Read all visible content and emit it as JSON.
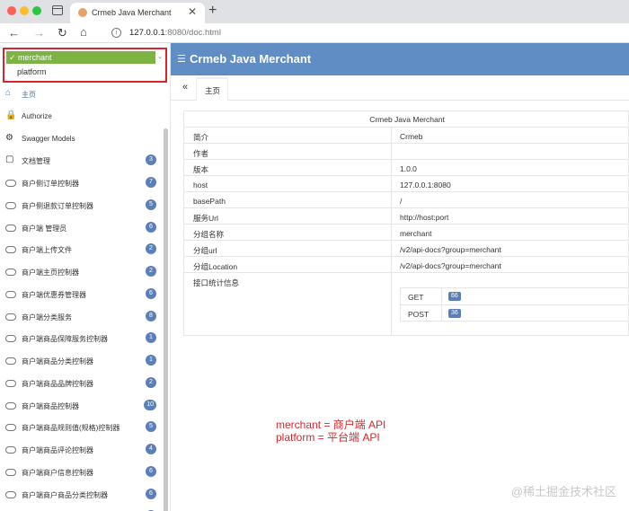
{
  "browser": {
    "tab_title": "Crmeb Java Merchant",
    "url_host": "127.0.0.1",
    "url_path": ":8080/doc.html",
    "close_glyph": "✕",
    "new_tab_glyph": "+"
  },
  "group_select": {
    "selected": "✓ merchant",
    "other": "platform"
  },
  "header": {
    "title": "Crmeb Java Merchant"
  },
  "tabs": {
    "current": "主页",
    "collapse_glyph": "«"
  },
  "sidebar": {
    "items": [
      {
        "label": "主页",
        "badge": null,
        "icon": "home-icon"
      },
      {
        "label": "Authorize",
        "badge": null,
        "icon": "lock-icon"
      },
      {
        "label": "Swagger Models",
        "badge": null,
        "icon": "models-icon"
      },
      {
        "label": "文档管理",
        "badge": "3",
        "icon": "folder-icon"
      },
      {
        "label": "商户侧订单控制器",
        "badge": "7",
        "icon": "cloud-icon"
      },
      {
        "label": "商户侧退款订单控制器",
        "badge": "5",
        "icon": "cloud-icon"
      },
      {
        "label": "商户端 管理员",
        "badge": "6",
        "icon": "cloud-icon"
      },
      {
        "label": "商户端上传文件",
        "badge": "2",
        "icon": "cloud-icon"
      },
      {
        "label": "商户端主页控制器",
        "badge": "2",
        "icon": "cloud-icon"
      },
      {
        "label": "商户端优惠券管理器",
        "badge": "6",
        "icon": "cloud-icon"
      },
      {
        "label": "商户端分类服务",
        "badge": "8",
        "icon": "cloud-icon"
      },
      {
        "label": "商户端商品保障服务控制器",
        "badge": "1",
        "icon": "cloud-icon"
      },
      {
        "label": "商户端商品分类控制器",
        "badge": "1",
        "icon": "cloud-icon"
      },
      {
        "label": "商户端商品品牌控制器",
        "badge": "2",
        "icon": "cloud-icon"
      },
      {
        "label": "商户端商品控制器",
        "badge": "10",
        "icon": "cloud-icon"
      },
      {
        "label": "商户端商品规则值(规格)控制器",
        "badge": "5",
        "icon": "cloud-icon"
      },
      {
        "label": "商户端商品评论控制器",
        "badge": "4",
        "icon": "cloud-icon"
      },
      {
        "label": "商户端商户信息控制器",
        "badge": "6",
        "icon": "cloud-icon"
      },
      {
        "label": "商户端商户商品分类控制器",
        "badge": "6",
        "icon": "cloud-icon"
      },
      {
        "label": "商户端管理日志控制器",
        "badge": "1",
        "icon": "cloud-icon"
      }
    ]
  },
  "info": {
    "title": "Crmeb Java Merchant",
    "rows": [
      {
        "key": "简介",
        "value": "Crmeb"
      },
      {
        "key": "作者",
        "value": ""
      },
      {
        "key": "版本",
        "value": "1.0.0"
      },
      {
        "key": "host",
        "value": "127.0.0.1:8080"
      },
      {
        "key": "basePath",
        "value": "/"
      },
      {
        "key": "服务Url",
        "value": "http://host:port"
      },
      {
        "key": "分组名称",
        "value": "merchant"
      },
      {
        "key": "分组url",
        "value": "/v2/api-docs?group=merchant"
      },
      {
        "key": "分组Location",
        "value": "/v2/api-docs?group=merchant"
      },
      {
        "key": "接口统计信息",
        "value": ""
      }
    ],
    "methods": [
      {
        "name": "GET",
        "count": "66"
      },
      {
        "name": "POST",
        "count": "36"
      }
    ]
  },
  "annotation": {
    "line1": "merchant = 商户端 API",
    "line2": "platform = 平台端 API"
  },
  "watermark": "@稀土掘金技术社区",
  "colors": {
    "header": "#5f8dc4",
    "badge": "#5b7fb8",
    "selected_option": "#7cb342",
    "highlight_box": "#d9262b"
  }
}
